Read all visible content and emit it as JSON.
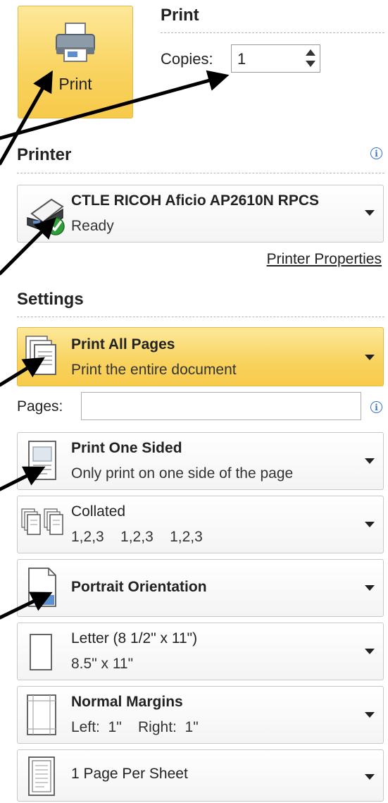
{
  "print_button": {
    "label": "Print",
    "icon": "printer-icon"
  },
  "print_section": {
    "title": "Print",
    "copies_label": "Copies:",
    "copies_value": "1"
  },
  "printer_section": {
    "title": "Printer",
    "printer": {
      "name": "CTLE RICOH Aficio AP2610N RPCS",
      "status": "Ready"
    },
    "properties_link": "Printer Properties"
  },
  "settings": {
    "title": "Settings",
    "pages_label": "Pages:",
    "pages_value": "",
    "items": [
      {
        "title": "Print All Pages",
        "subtitle": "Print the entire document",
        "icon": "all-pages-icon",
        "highlighted": true
      },
      {
        "title": "Print One Sided",
        "subtitle": "Only print on one side of the page",
        "icon": "one-sided-icon"
      },
      {
        "title": "Collated",
        "subtitle": "1,2,3    1,2,3    1,2,3",
        "icon": "collated-icon"
      },
      {
        "title": "Portrait Orientation",
        "subtitle": "",
        "icon": "portrait-icon"
      },
      {
        "title": "Letter (8 1/2\" x 11\")",
        "subtitle": "8.5\" x 11\"",
        "icon": "letter-icon"
      },
      {
        "title": "Normal Margins",
        "subtitle": "Left:  1\"    Right:  1\"",
        "icon": "margins-icon"
      },
      {
        "title": "1 Page Per Sheet",
        "subtitle": "",
        "icon": "page-per-sheet-icon"
      }
    ]
  },
  "colors": {
    "highlight": "#f9d462",
    "accent_border": "#e3b94a",
    "info_blue": "#3a74c5"
  }
}
